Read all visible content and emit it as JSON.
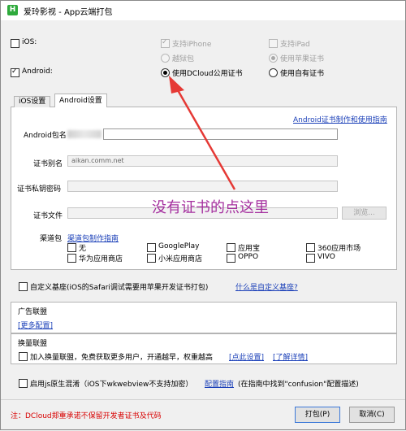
{
  "window": {
    "title": "爱玲影视 - App云端打包",
    "icon": "H"
  },
  "platforms": {
    "ios_label": "iOS:",
    "android_label": "Android:",
    "ios_options": {
      "iphone": "支持iPhone",
      "ipad": "支持iPad",
      "jailbreak": "越狱包",
      "apple_cert": "使用苹果证书"
    },
    "android_options": {
      "dcloud_cert": "使用DCloud公用证书",
      "own_cert": "使用自有证书"
    }
  },
  "tabs": [
    {
      "label": "iOS设置"
    },
    {
      "label": "Android设置"
    }
  ],
  "android": {
    "cert_guide_link": "Android证书制作和使用指南",
    "package_label": "Android包名",
    "alias_label": "证书别名",
    "alias_value": "aikan.comm.net",
    "password_label": "证书私钥密码",
    "file_label": "证书文件",
    "browse_label": "浏览...",
    "channel_label": "渠道包",
    "channel_guide_link": "渠道包制作指南",
    "channels": [
      {
        "label": "无"
      },
      {
        "label": "GooglePlay"
      },
      {
        "label": "应用宝"
      },
      {
        "label": "360应用市场"
      },
      {
        "label": "华为应用商店"
      },
      {
        "label": "小米应用商店"
      },
      {
        "label": "OPPO"
      },
      {
        "label": "VIVO"
      }
    ]
  },
  "annotation": "没有证书的点这里",
  "custom_base": {
    "label": "自定义基座(iOS的Safari调试需要用苹果开发证书打包)",
    "link": "什么是自定义基座?"
  },
  "ad_alliance": {
    "title": "广告联盟",
    "link": "[更多配置]"
  },
  "exchange_alliance": {
    "title": "换量联盟",
    "label": "加入换量联盟，免费获取更多用户，开通越早，权重越高",
    "link1": "[点此设置]",
    "link2": "[了解详情]"
  },
  "js_obfuscation": {
    "label": "启用js原生混淆（iOS下wkwebview不支持加密）",
    "link": "配置指南",
    "hint": "(在指南中找到\"confusion\"配置描述)"
  },
  "footer": {
    "note": "注：DCloud郑重承诺不保留开发者证书及代码",
    "pack_button": "打包(P)",
    "cancel_button": "取消(C)"
  },
  "colors": {
    "annotation": "#a5309f",
    "arrow": "#e53935",
    "link": "#1a3fb8",
    "warning": "#d80000"
  }
}
